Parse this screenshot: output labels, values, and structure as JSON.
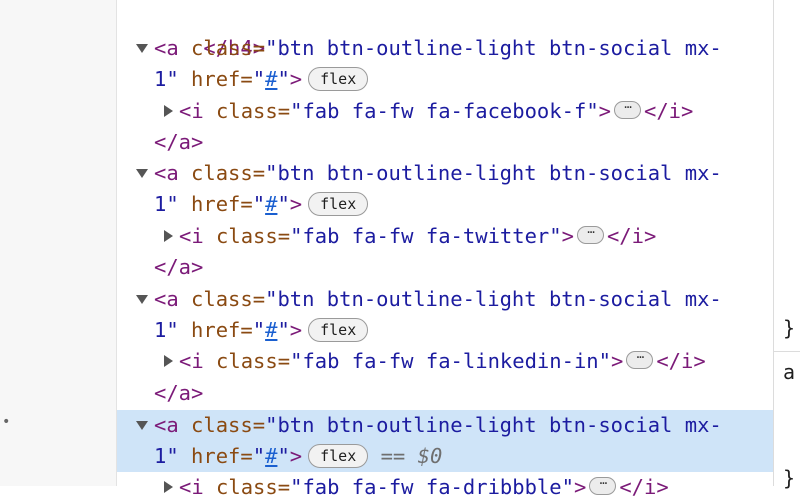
{
  "tree": {
    "lines": [
      {
        "kind": "close",
        "text": "</h4>"
      },
      {
        "kind": "open_a",
        "class_l1": "btn btn-outline-light btn-social mx-",
        "class_l2": "1",
        "href": "#",
        "badge": "flex"
      },
      {
        "kind": "child_i",
        "class": "fab fa-fw fa-facebook-f"
      },
      {
        "kind": "close",
        "text": "</a>"
      },
      {
        "kind": "open_a",
        "class_l1": "btn btn-outline-light btn-social mx-",
        "class_l2": "1",
        "href": "#",
        "badge": "flex"
      },
      {
        "kind": "child_i",
        "class": "fab fa-fw fa-twitter"
      },
      {
        "kind": "close",
        "text": "</a>"
      },
      {
        "kind": "open_a",
        "class_l1": "btn btn-outline-light btn-social mx-",
        "class_l2": "1",
        "href": "#",
        "badge": "flex"
      },
      {
        "kind": "child_i",
        "class": "fab fa-fw fa-linkedin-in"
      },
      {
        "kind": "close",
        "text": "</a>"
      },
      {
        "kind": "open_a_selected",
        "class_l1": "btn btn-outline-light btn-social mx-",
        "class_l2": "1",
        "href": "#",
        "badge": "flex",
        "eq": "==",
        "var": "$0"
      },
      {
        "kind": "child_i",
        "class": "fab fa-fw fa-dribbble"
      }
    ],
    "text": {
      "close_h4": "</h4>",
      "close_a": "</a>",
      "a_open": "<a",
      "attr_class": "class=",
      "attr_href": "href=",
      "quote": "\"",
      "gt": ">",
      "i_open": "<i",
      "i_close": "</i>"
    },
    "a1": {
      "class_l1": "btn btn-outline-light btn-social mx-",
      "class_l2": "1",
      "href": "#",
      "badge": "flex"
    },
    "i1": {
      "class": "fab fa-fw fa-facebook-f"
    },
    "a2": {
      "class_l1": "btn btn-outline-light btn-social mx-",
      "class_l2": "1",
      "href": "#",
      "badge": "flex"
    },
    "i2": {
      "class": "fab fa-fw fa-twitter"
    },
    "a3": {
      "class_l1": "btn btn-outline-light btn-social mx-",
      "class_l2": "1",
      "href": "#",
      "badge": "flex"
    },
    "i3": {
      "class": "fab fa-fw fa-linkedin-in"
    },
    "a4": {
      "class_l1": "btn btn-outline-light btn-social mx-",
      "class_l2": "1",
      "href": "#",
      "badge": "flex",
      "eq": "==",
      "var": "$0"
    },
    "i4": {
      "class": "fab fa-fw fa-dribbble"
    },
    "ellipsis": "⋯"
  },
  "right_pane": {
    "brace": "}",
    "letter": "a"
  },
  "colors": {
    "tag": "#7b1a78",
    "attr": "#8a4a12",
    "value": "#1c1ca0",
    "link": "#1a5fd0",
    "selection": "#cfe4f8"
  },
  "icons": {
    "expanded": "disclosure-triangle-down-icon",
    "collapsed": "disclosure-triangle-right-icon",
    "more": "ellipsis-icon"
  }
}
